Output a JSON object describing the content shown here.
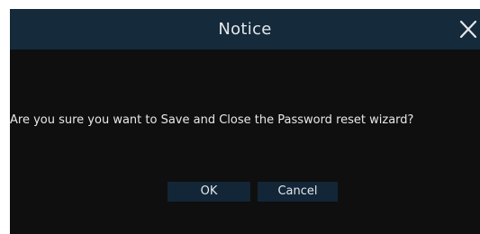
{
  "dialog": {
    "title": "Notice",
    "message": "Are you sure you want to Save and Close the Password reset wizard?",
    "buttons": {
      "ok_label": "OK",
      "cancel_label": "Cancel"
    },
    "close_icon": "close-icon"
  },
  "colors": {
    "titlebar_bg": "#152a3b",
    "body_bg": "#0f0f0f",
    "button_bg": "#122637",
    "text": "#e4e8ec"
  }
}
